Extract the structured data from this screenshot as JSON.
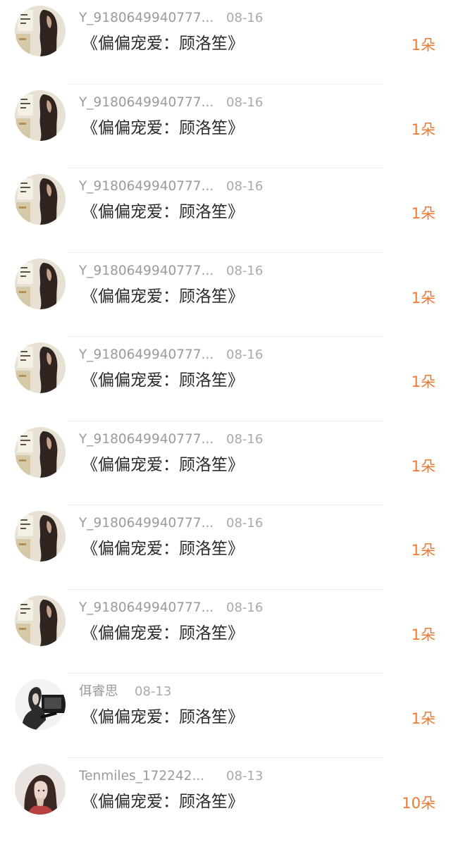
{
  "rows": [
    {
      "name": "Y_9180649940777...",
      "date": "08-16",
      "title": "《偏偏宠爱：顾洛笙》",
      "amount": "1朵",
      "avatar": "girl-long-hair-avatar"
    },
    {
      "name": "Y_9180649940777...",
      "date": "08-16",
      "title": "《偏偏宠爱：顾洛笙》",
      "amount": "1朵",
      "avatar": "girl-long-hair-avatar"
    },
    {
      "name": "Y_9180649940777...",
      "date": "08-16",
      "title": "《偏偏宠爱：顾洛笙》",
      "amount": "1朵",
      "avatar": "girl-long-hair-avatar"
    },
    {
      "name": "Y_9180649940777...",
      "date": "08-16",
      "title": "《偏偏宠爱：顾洛笙》",
      "amount": "1朵",
      "avatar": "girl-long-hair-avatar"
    },
    {
      "name": "Y_9180649940777...",
      "date": "08-16",
      "title": "《偏偏宠爱：顾洛笙》",
      "amount": "1朵",
      "avatar": "girl-long-hair-avatar"
    },
    {
      "name": "Y_9180649940777...",
      "date": "08-16",
      "title": "《偏偏宠爱：顾洛笙》",
      "amount": "1朵",
      "avatar": "girl-long-hair-avatar"
    },
    {
      "name": "Y_9180649940777...",
      "date": "08-16",
      "title": "《偏偏宠爱：顾洛笙》",
      "amount": "1朵",
      "avatar": "girl-long-hair-avatar"
    },
    {
      "name": "Y_9180649940777...",
      "date": "08-16",
      "title": "《偏偏宠爱：顾洛笙》",
      "amount": "1朵",
      "avatar": "girl-long-hair-avatar"
    },
    {
      "name": "佴睿思",
      "date": "08-13",
      "title": "《偏偏宠爱：顾洛笙》",
      "amount": "1朵",
      "avatar": "woman-profile-avatar"
    },
    {
      "name": "Tenmiles_172242...",
      "date": "08-13",
      "title": "《偏偏宠爱：顾洛笙》",
      "amount": "10朵",
      "avatar": "woman-portrait-avatar"
    }
  ],
  "colors": {
    "amount": "#f07a32",
    "name": "#9b9b9b",
    "title": "#2b2b2b"
  }
}
